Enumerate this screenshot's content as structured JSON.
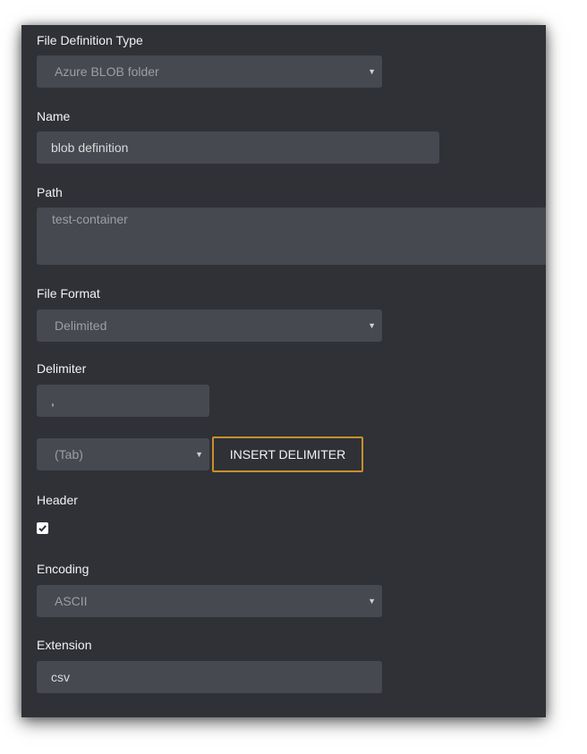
{
  "form": {
    "file_definition_type": {
      "label": "File Definition Type",
      "selected": "Azure BLOB folder"
    },
    "name": {
      "label": "Name",
      "value": "blob definition"
    },
    "path": {
      "label": "Path",
      "value": "test-container"
    },
    "file_format": {
      "label": "File Format",
      "selected": "Delimited"
    },
    "delimiter": {
      "label": "Delimiter",
      "value": ",",
      "select_selected": "(Tab)",
      "insert_button_label": "INSERT DELIMITER"
    },
    "header": {
      "label": "Header",
      "checked": true
    },
    "encoding": {
      "label": "Encoding",
      "selected": "ASCII"
    },
    "extension": {
      "label": "Extension",
      "value": "csv"
    }
  },
  "colors": {
    "panel_background": "#2f3137",
    "field_background": "#464950",
    "button_border": "#c8902a"
  },
  "icons": {
    "dropdown": "caret-down-icon",
    "checkbox": "checkmark-icon"
  }
}
